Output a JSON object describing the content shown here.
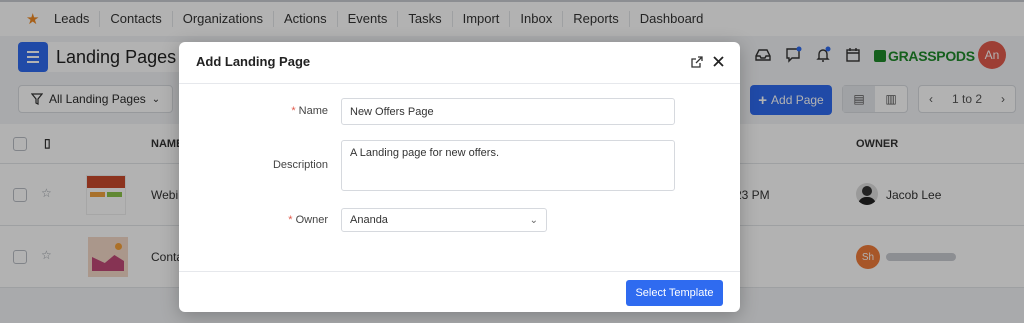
{
  "nav": {
    "items": [
      "Leads",
      "Contacts",
      "Organizations",
      "Actions",
      "Events",
      "Tasks",
      "Import",
      "Inbox",
      "Reports",
      "Dashboard"
    ]
  },
  "header": {
    "title": "Landing Pages",
    "brand": "GRASSPODS",
    "avatar_initials": "An"
  },
  "toolbar": {
    "filter_label": "All Landing Pages",
    "add_label": "Add Page",
    "pager_text": "1 to 2"
  },
  "table": {
    "columns": {
      "name": "NAME",
      "owner": "OWNER"
    },
    "rows": [
      {
        "name": "Webi",
        "time": "23 PM",
        "owner_name": "Jacob Lee",
        "owner_initials": ""
      },
      {
        "name": "Conta",
        "time": "",
        "owner_name": "",
        "owner_initials": "Sh"
      }
    ]
  },
  "modal": {
    "title": "Add Landing Page",
    "name_label": "Name",
    "name_value": "New Offers Page",
    "description_label": "Description",
    "description_value": "A Landing page for new offers.",
    "owner_label": "Owner",
    "owner_value": "Ananda",
    "required_mark": "*",
    "submit_label": "Select Template"
  },
  "colors": {
    "accent": "#2f6bf0",
    "required": "#e15b4d",
    "brand": "#1f8a2a"
  }
}
